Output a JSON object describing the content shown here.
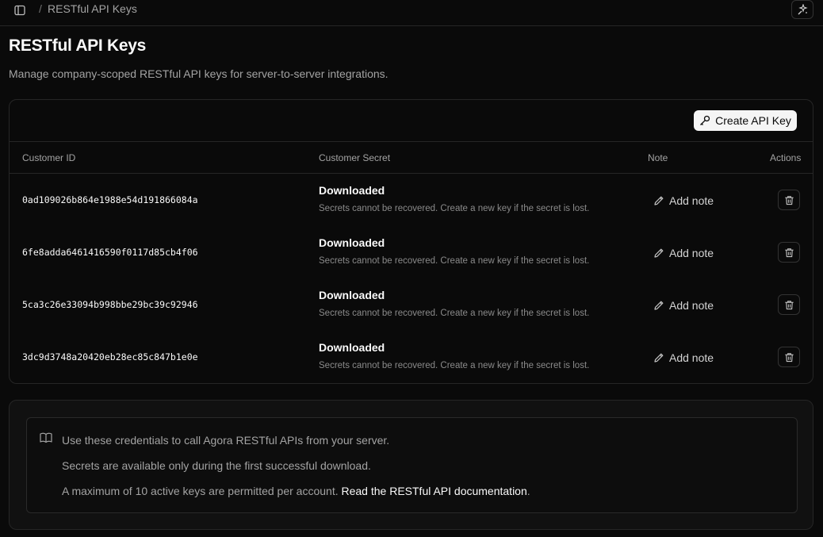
{
  "breadcrumb": {
    "separator": "/",
    "current": "RESTful API Keys"
  },
  "page": {
    "title": "RESTful API Keys",
    "description": "Manage company-scoped RESTful API keys for server-to-server integrations."
  },
  "toolbar": {
    "create_label": "Create API Key"
  },
  "table": {
    "headers": [
      "Customer ID",
      "Customer Secret",
      "Note",
      "Actions"
    ],
    "rows": [
      {
        "customer_id": "0ad109026b864e1988e54d191866084a",
        "secret_status": "Downloaded",
        "secret_note": "Secrets cannot be recovered. Create a new key if the secret is lost.",
        "note_label": "Add note"
      },
      {
        "customer_id": "6fe8adda6461416590f0117d85cb4f06",
        "secret_status": "Downloaded",
        "secret_note": "Secrets cannot be recovered. Create a new key if the secret is lost.",
        "note_label": "Add note"
      },
      {
        "customer_id": "5ca3c26e33094b998bbe29bc39c92946",
        "secret_status": "Downloaded",
        "secret_note": "Secrets cannot be recovered. Create a new key if the secret is lost.",
        "note_label": "Add note"
      },
      {
        "customer_id": "3dc9d3748a20420eb28ec85c847b1e0e",
        "secret_status": "Downloaded",
        "secret_note": "Secrets cannot be recovered. Create a new key if the secret is lost.",
        "note_label": "Add note"
      }
    ]
  },
  "info": {
    "line1": "Use these credentials to call Agora RESTful APIs from your server.",
    "line2": "Secrets are available only during the first successful download.",
    "line3_prefix": "A maximum of 10 active keys are permitted per account. ",
    "line3_link": "Read the RESTful API documentation",
    "line3_suffix": "."
  },
  "icons": {
    "sidebar_toggle": "sidebar-icon",
    "magic": "sparkles-icon",
    "create": "key-icon",
    "note": "pencil-icon",
    "delete": "trash-icon",
    "info": "book-icon"
  },
  "colors": {
    "background": "#0a0a0a",
    "primary_button": "#f5f5f5",
    "border": "#262626"
  }
}
